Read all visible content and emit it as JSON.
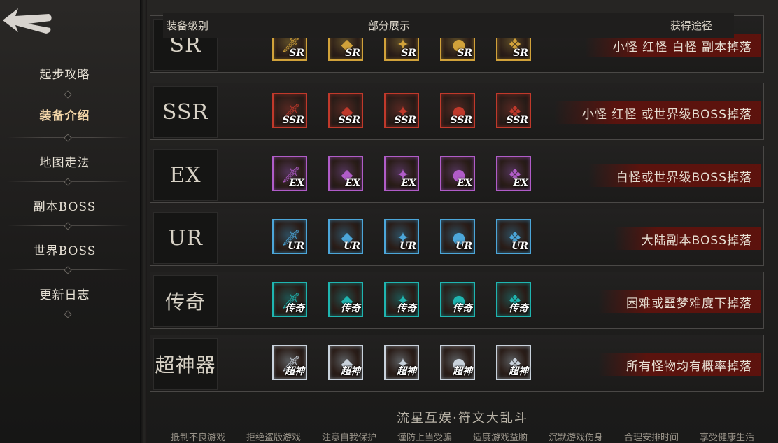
{
  "nav": {
    "items": [
      {
        "label": "起步攻略"
      },
      {
        "label": "装备介绍",
        "active": true
      },
      {
        "label": "地图走法"
      },
      {
        "label": "副本BOSS"
      },
      {
        "label": "世界BOSS"
      },
      {
        "label": "更新日志"
      }
    ]
  },
  "header": {
    "col_grade": "装备级别",
    "col_items": "部分展示",
    "col_source": "获得途径"
  },
  "rows": [
    {
      "grade": "SR",
      "tag": "SR",
      "color": "#d1a23a",
      "source": "小怪 红怪 白怪 副本掉落",
      "icons": [
        "sword-icon",
        "jade-pendant-icon",
        "gem-icon",
        "orb-icon",
        "amulet-icon"
      ]
    },
    {
      "grade": "SSR",
      "tag": "SSR",
      "color": "#c0392b",
      "source": "小怪 红怪 或世界级BOSS掉落",
      "icons": [
        "emerald-orb-icon",
        "golden-flower-icon",
        "ruby-crown-icon",
        "winged-helm-icon",
        "golden-staff-icon"
      ]
    },
    {
      "grade": "EX",
      "tag": "EX",
      "color": "#b05cc8",
      "source": "白怪或世界级BOSS掉落",
      "icons": [
        "dark-orb-icon",
        "flame-cauldron-icon",
        "gauntlet-icon",
        "feather-fan-icon",
        "crimson-blade-icon"
      ]
    },
    {
      "grade": "UR",
      "tag": "UR",
      "color": "#4ca6d9",
      "source": "大陆副本BOSS掉落",
      "icons": [
        "golden-wing-icon",
        "blue-star-icon",
        "fire-gauntlet-icon",
        "dragon-relic-icon",
        "silver-spear-icon"
      ]
    },
    {
      "grade": "传奇",
      "tag": "传奇",
      "color": "#1fb5b0",
      "source": "困难或噩梦难度下掉落",
      "icons": [
        "teal-beast-icon",
        "red-eye-icon",
        "rune-stone-icon",
        "crimson-seal-icon",
        "azure-vortex-icon"
      ]
    },
    {
      "grade": "超神器",
      "tag": "超神",
      "color": "#c9d2dc",
      "source": "所有怪物均有概率掉落",
      "icons": [
        "spectral-beast-icon",
        "golden-disc-icon",
        "rainbow-star-icon",
        "dark-sword-icon",
        "flame-armor-icon"
      ]
    }
  ],
  "footer": {
    "title": "流星互娱·符文大乱斗",
    "links": [
      "抵制不良游戏",
      "拒绝盗版游戏",
      "注意自我保护",
      "谨防上当受骗",
      "适度游戏益脑",
      "沉默游戏伤身",
      "合理安排时间",
      "享受健康生活"
    ]
  }
}
